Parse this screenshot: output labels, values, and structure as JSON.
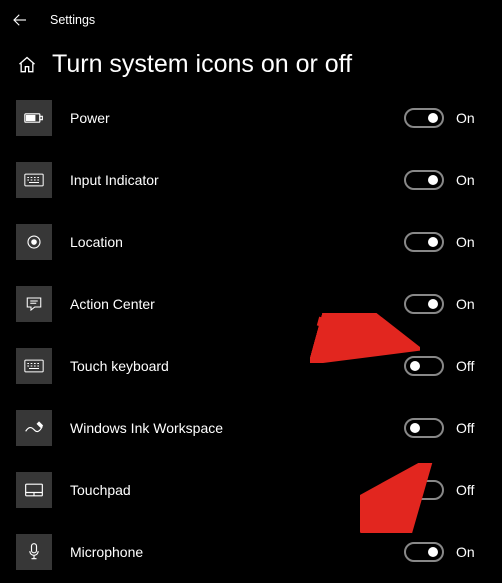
{
  "header": {
    "title": "Settings"
  },
  "page": {
    "title": "Turn system icons on or off"
  },
  "states": {
    "on": "On",
    "off": "Off"
  },
  "items": [
    {
      "key": "power",
      "label": "Power",
      "on": true
    },
    {
      "key": "input",
      "label": "Input Indicator",
      "on": true
    },
    {
      "key": "location",
      "label": "Location",
      "on": true
    },
    {
      "key": "actioncenter",
      "label": "Action Center",
      "on": true
    },
    {
      "key": "touchkeyboard",
      "label": "Touch keyboard",
      "on": false
    },
    {
      "key": "ink",
      "label": "Windows Ink Workspace",
      "on": false
    },
    {
      "key": "touchpad",
      "label": "Touchpad",
      "on": false
    },
    {
      "key": "microphone",
      "label": "Microphone",
      "on": true
    }
  ]
}
